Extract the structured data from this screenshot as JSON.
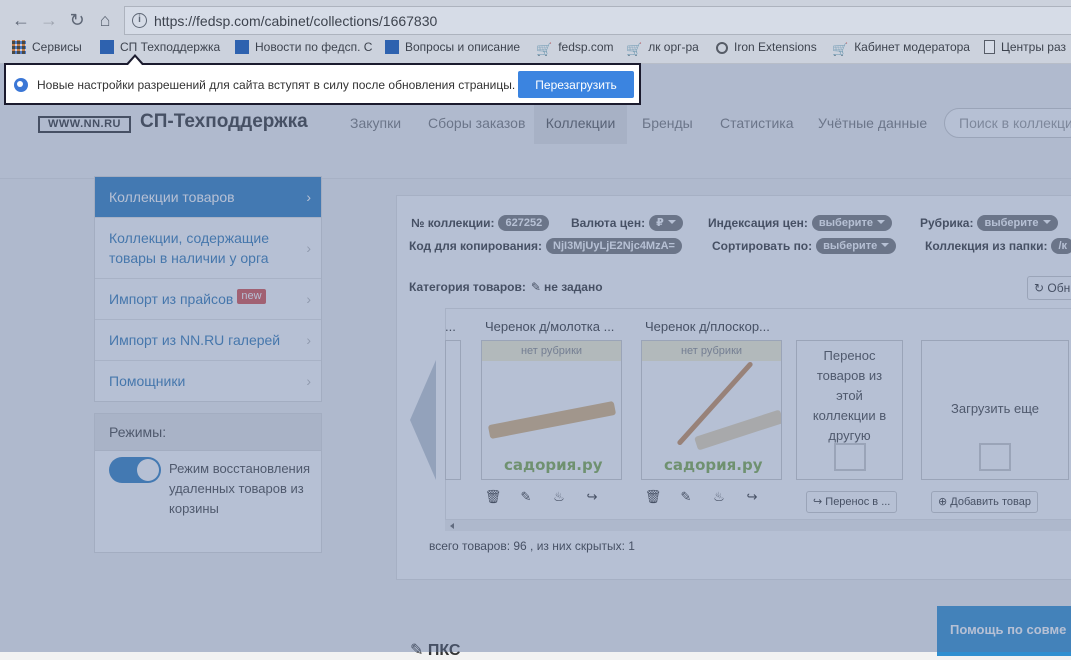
{
  "browser": {
    "url": "https://fedsp.com/cabinet/collections/1667830",
    "bookmarks": [
      {
        "label": "Сервисы",
        "icon": "apps-grid-icon"
      },
      {
        "label": "СП Техподдержка",
        "icon": "site-favicon-icon"
      },
      {
        "label": "Новости по федсп. С",
        "icon": "site-favicon-icon"
      },
      {
        "label": "Вопросы и описание",
        "icon": "site-favicon-icon"
      },
      {
        "label": "fedsp.com",
        "icon": "cart-icon"
      },
      {
        "label": "лк орг-ра",
        "icon": "cart-icon"
      },
      {
        "label": "Iron Extensions",
        "icon": "gear-icon"
      },
      {
        "label": "Кабинет модератора",
        "icon": "cart-icon"
      },
      {
        "label": "Центры раз",
        "icon": "document-icon"
      }
    ]
  },
  "infobar": {
    "message": "Новые настройки разрешений для сайта вступят в силу после обновления страницы.",
    "reload_label": "Перезагрузить"
  },
  "header": {
    "logo": "WWW.NN.RU",
    "title": "СП-Техподдержка",
    "nav": [
      "Закупки",
      "Сборы заказов",
      "Коллекции",
      "Бренды",
      "Статистика",
      "Учётные данные"
    ],
    "active_nav": "Коллекции",
    "search_placeholder": "Поиск в коллекция"
  },
  "left_menu": {
    "items": [
      {
        "label": "Коллекции товаров",
        "active": true
      },
      {
        "label": "Коллекции, содержащие товары в наличии у орга",
        "active": false
      },
      {
        "label": "Импорт из прайсов",
        "badge": "new",
        "active": false
      },
      {
        "label": "Импорт из NN.RU галерей",
        "active": false
      },
      {
        "label": "Помощники",
        "active": false
      }
    ]
  },
  "modes": {
    "title": "Режимы:",
    "toggle_on": true,
    "toggle_label": "Режим восстановления удаленных товаров из корзины"
  },
  "collection": {
    "number_label": "№ коллекции:",
    "number_value": "627252",
    "currency_label": "Валюта цен:",
    "currency_value": "₽",
    "indexing_label": "Индексация цен:",
    "indexing_value": "выберите",
    "rubric_label": "Рубрика:",
    "rubric_value": "выберите",
    "copy_code_label": "Код для копирования:",
    "copy_code_value": "NjI3MjUyLjE2Njc4MzA=",
    "sort_label": "Сортировать по:",
    "sort_value": "выберите",
    "folder_label": "Коллекция из папки:",
    "folder_value": "/к",
    "category_label": "Категория товаров:",
    "category_value": "не задано",
    "refresh_label": "Обн",
    "total_text": "всего товаров: 96 , из них скрытых: 1"
  },
  "products": [
    {
      "title": "Черенок д/молотка ...",
      "rubric": "нет рубрики",
      "brand": "садория.ру"
    },
    {
      "title": "Черенок д/плоскор...",
      "rubric": "нет рубрики",
      "brand": "садория.ру"
    }
  ],
  "partial_title": "...",
  "actions": {
    "move_card_text": "Перенос товаров из этой коллекции в другую",
    "move_button": "Перенос в ...",
    "load_more": "Загрузить еще",
    "add_product": "Добавить товар"
  },
  "help_button": "Помощь по совме",
  "bottom_heading": "ПКС",
  "colors": {
    "accent": "#2f7ec1",
    "infobar_button": "#3b84e0",
    "overlay": "#5d74a0",
    "badge_new": "#d9534f"
  }
}
